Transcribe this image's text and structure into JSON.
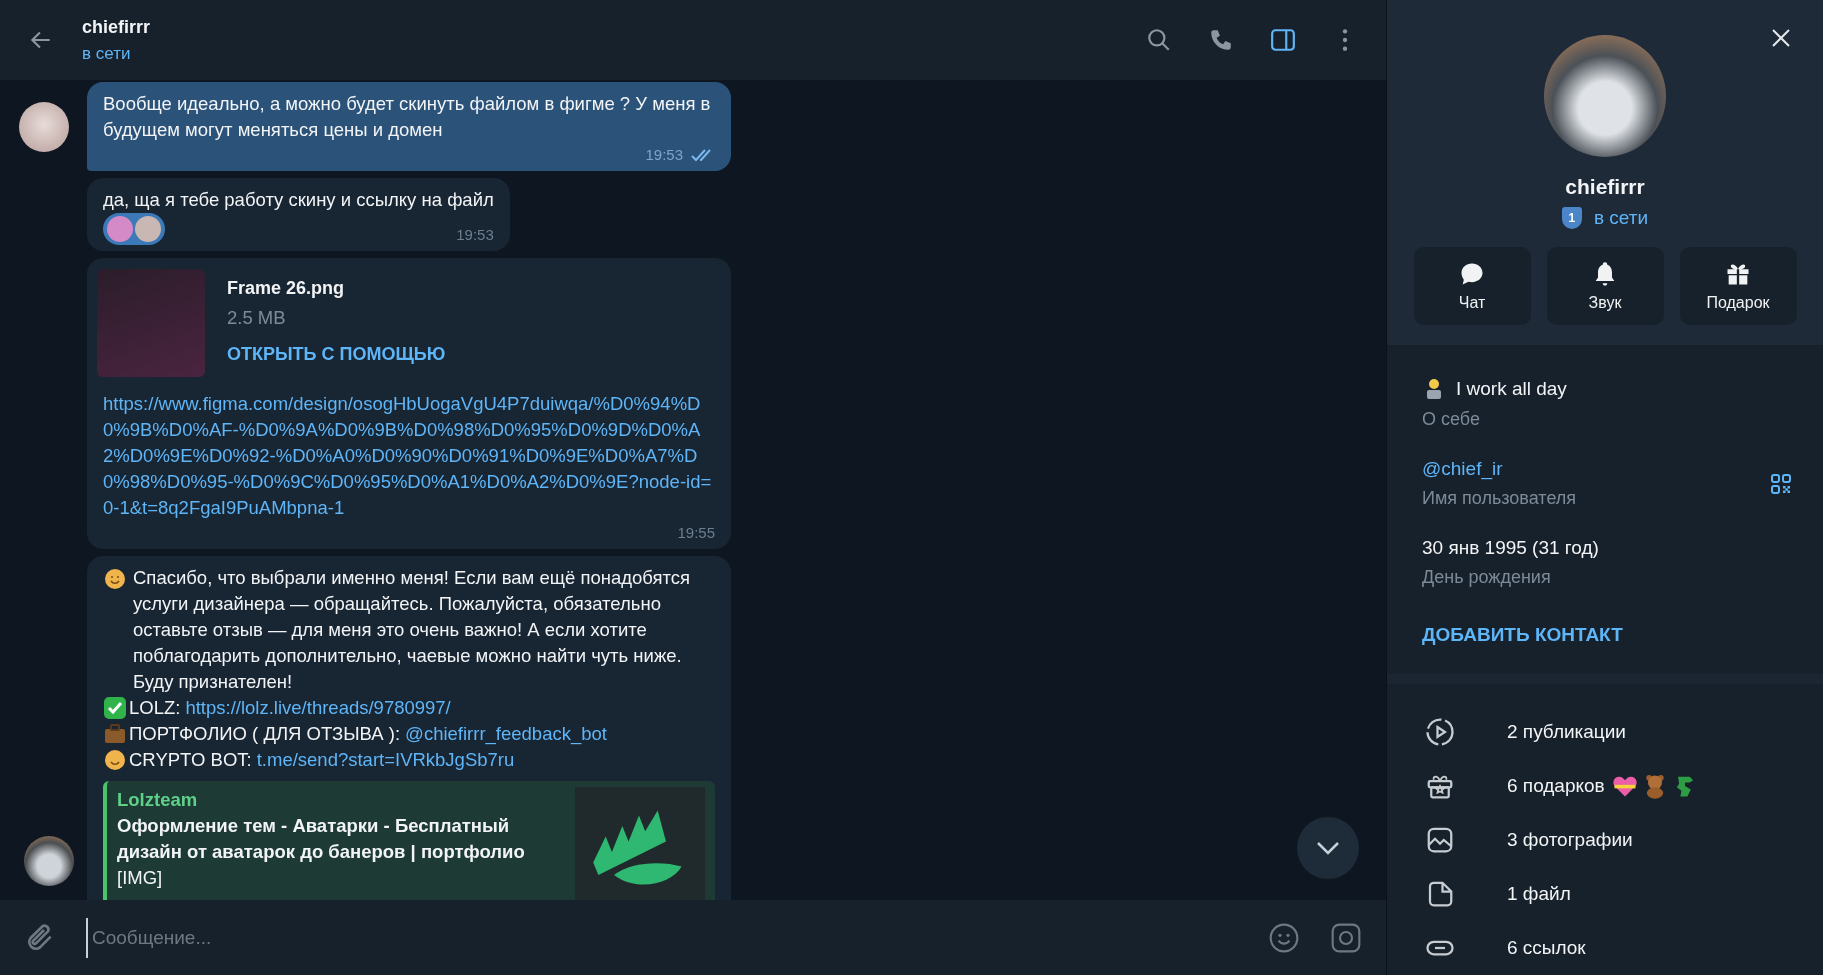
{
  "chat_header": {
    "name": "chiefirrr",
    "status": "в сети",
    "panel_open": true
  },
  "messages": [
    {
      "kind": "text",
      "outgoing": true,
      "show_avatar": true,
      "reaction": false,
      "text": "Вообще идеально, а можно будет скинуть файлом в фигме ? У меня в будущем могут меняться цены и домен",
      "time": "19:53",
      "read": true
    },
    {
      "kind": "text",
      "outgoing": false,
      "show_avatar": false,
      "reaction": true,
      "text": "да, ща я тебе работу скину и ссылку на файл",
      "time": "19:53",
      "read": false
    },
    {
      "kind": "file",
      "outgoing": false,
      "show_avatar": false,
      "reaction": false,
      "file_name": "Frame 26.png",
      "file_size": "2.5 MB",
      "action": "ОТКРЫТЬ С ПОМОЩЬЮ",
      "link": "https://www.figma.com/design/osogHbUogaVgU4P7duiwqa/%D0%94%D0%9B%D0%AF-%D0%9A%D0%9B%D0%98%D0%95%D0%9D%D0%A2%D0%9E%D0%92-%D0%A0%D0%90%D0%91%D0%9E%D0%A7%D0%98%D0%95-%D0%9C%D0%95%D0%A1%D0%A2%D0%9E?node-id=0-1&t=8q2FgaI9PuAMbpna-1",
      "time": "19:55",
      "read": false
    },
    {
      "kind": "rich",
      "outgoing": false,
      "show_avatar": false,
      "reaction": false,
      "text": "Спасибо, что выбрали именно меня! Если вам ещё понадобятся услуги дизайнера — обращайтесь. Пожалуйста, обязательно оставьте отзыв — для меня это очень важно! А если хотите поблагодарить дополнительно, чаевые можно найти чуть ниже. Буду признателен!",
      "lines": [
        {
          "kind": "check",
          "label": "LOLZ:",
          "link": "https://lolz.live/threads/9780997/"
        },
        {
          "kind": "briefcase",
          "label": "ПОРТФОЛИО ( ДЛЯ ОТЗЫВА ):",
          "link": "@chiefirrr_feedback_bot"
        },
        {
          "kind": "smile",
          "label": "CRYPTO BOT:",
          "link": "t.me/send?start=IVRkbJgSb7ru"
        }
      ],
      "preview": {
        "site": "Lolzteam",
        "title": "Оформление тем - Аватарки - Бесплатный дизайн от аватарок до банеров | портфолио",
        "description": "[IMG]"
      },
      "read": false
    }
  ],
  "composer": {
    "placeholder": "Сообщение..."
  },
  "profile": {
    "name": "chiefirrr",
    "badge": "1",
    "status": "в сети",
    "actions": [
      {
        "kind": "chat",
        "label": "Чат"
      },
      {
        "kind": "bell",
        "label": "Звук"
      },
      {
        "kind": "gift",
        "label": "Подарок"
      }
    ],
    "info": [
      {
        "kind": "bio",
        "value": "I work all day",
        "label": "О себе"
      },
      {
        "kind": "username",
        "value": "@chief_ir",
        "label": "Имя пользователя"
      },
      {
        "kind": "plain",
        "value": "30 янв 1995 (31 год)",
        "label": "День рождения"
      }
    ],
    "add_contact": "ДОБАВИТЬ КОНТАКТ",
    "media": [
      {
        "kind": "posts",
        "text": "2 публикации"
      },
      {
        "kind": "gifts",
        "text": "6 подарков"
      },
      {
        "kind": "photos",
        "text": "3 фотографии"
      },
      {
        "kind": "files",
        "text": "1 файл"
      },
      {
        "kind": "links",
        "text": "6 ссылок"
      }
    ]
  }
}
